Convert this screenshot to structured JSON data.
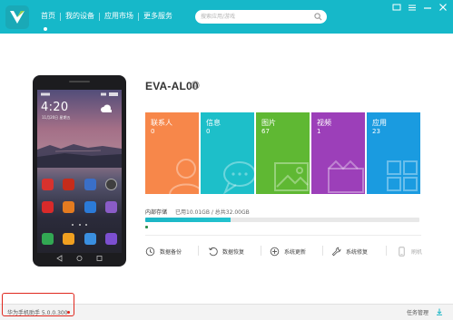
{
  "header": {
    "nav": [
      {
        "label": "首页",
        "active": true
      },
      {
        "label": "我的设备"
      },
      {
        "label": "应用市场"
      },
      {
        "label": "更多服务"
      }
    ],
    "search_placeholder": "搜索应用/游戏",
    "window_icons": [
      "minimize-to-tray-icon",
      "menu-icon",
      "minimize-icon",
      "close-icon"
    ]
  },
  "phone": {
    "clock": "4:20",
    "date": "11月20日 星期五",
    "apps_row1": [
      "#d8322e",
      "#c62c1b",
      "#3a6fc8",
      "#444444"
    ],
    "apps_row2": [
      "#d92a2a",
      "#e47b20",
      "#2b7ad8",
      "#8a5cc7"
    ],
    "dock": [
      "#32a853",
      "#f0a020",
      "#3a8fe0",
      "#7c4fd0"
    ]
  },
  "device": {
    "name": "EVA-AL00",
    "tiles": [
      {
        "label": "联系人",
        "count": "0",
        "color": "#f7874a",
        "icon": "contacts-icon"
      },
      {
        "label": "信息",
        "count": "0",
        "color": "#1dbfc9",
        "icon": "message-icon"
      },
      {
        "label": "图片",
        "count": "67",
        "color": "#5fb833",
        "icon": "image-icon"
      },
      {
        "label": "视频",
        "count": "1",
        "color": "#9c3fb9",
        "icon": "video-icon"
      },
      {
        "label": "应用",
        "count": "23",
        "color": "#1a9be0",
        "icon": "apps-icon"
      }
    ],
    "storage": {
      "label": "内部存储",
      "detail": "已用10.01GB / 总共32.00GB",
      "used_fraction": 0.31
    },
    "actions": [
      {
        "label": "数据备份",
        "icon": "backup-clock-icon"
      },
      {
        "label": "数据恢复",
        "icon": "restore-icon"
      },
      {
        "label": "系统更新",
        "icon": "update-icon"
      },
      {
        "label": "系统修复",
        "icon": "repair-wrench-icon"
      },
      {
        "label": "刷机",
        "icon": "flash-phone-icon"
      }
    ]
  },
  "footer": {
    "version": "华为手机助手 5.0.0.300",
    "task_manager": "任务管理"
  },
  "colors": {
    "header": "#16b8c9",
    "accent": "#1bb5c5",
    "highlight": "#e0281e"
  }
}
